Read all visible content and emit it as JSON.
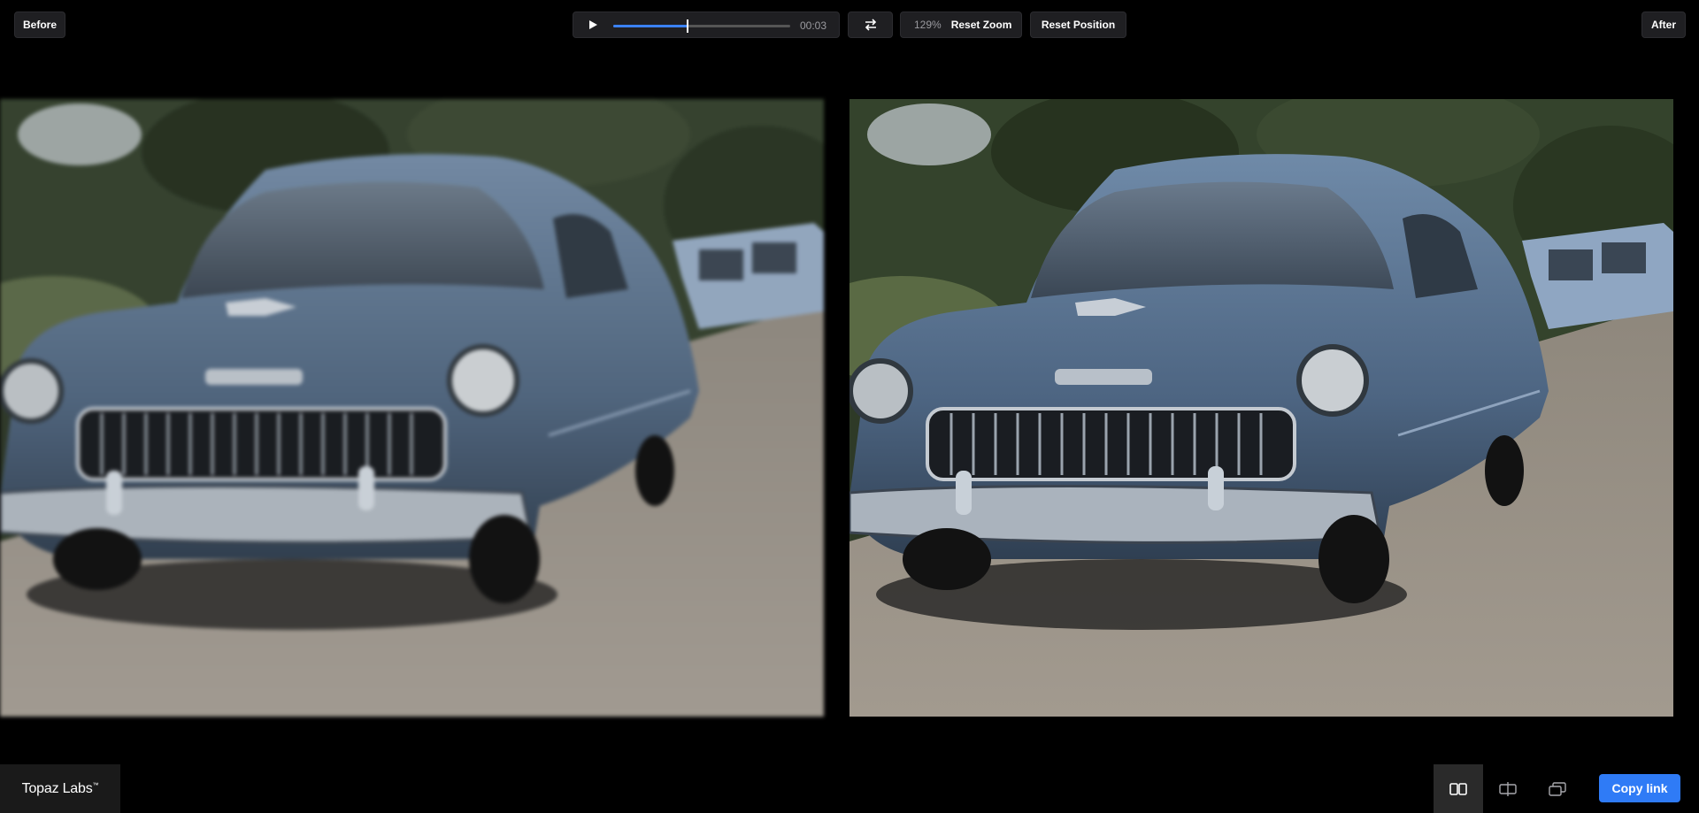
{
  "header": {
    "before_label": "Before",
    "after_label": "After",
    "player": {
      "time": "00:03",
      "progress": 0.42
    },
    "zoom": {
      "percent": "129%",
      "reset_label": "Reset Zoom"
    },
    "reset_position_label": "Reset Position",
    "icons": {
      "play": "play-icon",
      "swap": "swap-arrows-icon"
    }
  },
  "footer": {
    "brand": "Topaz Labs",
    "brand_mark": "™",
    "copy_link_label": "Copy link",
    "view_modes": [
      {
        "name": "side-by-side-icon",
        "active": true
      },
      {
        "name": "split-view-icon",
        "active": false
      },
      {
        "name": "overlay-view-icon",
        "active": false
      }
    ]
  },
  "colors": {
    "accent": "#2f7bf6",
    "background": "#000000",
    "panel": "#1f1f22"
  }
}
